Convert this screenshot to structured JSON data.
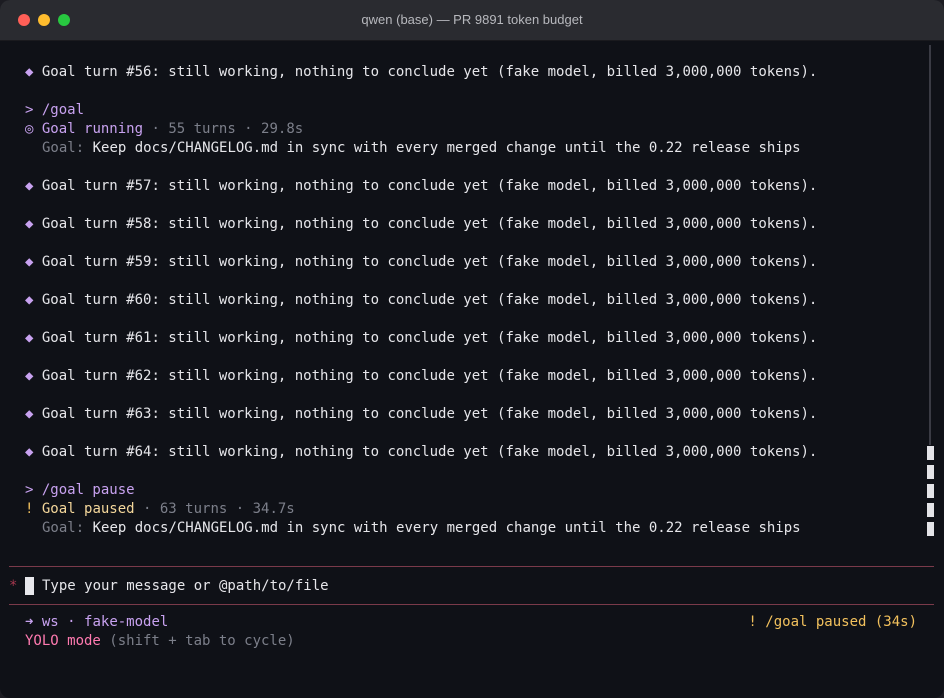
{
  "window": {
    "title": "qwen (base) — PR 9891 token budget"
  },
  "transcript": {
    "turn56": "Goal turn #56: still working, nothing to conclude yet (fake model, billed 3,000,000 tokens).",
    "cmd_goal": "> /goal",
    "running": {
      "icon": "◎",
      "status": "Goal running",
      "meta": " · 55 turns · 29.8s"
    },
    "goal_label": "Goal:",
    "goal_text": " Keep docs/CHANGELOG.md in sync with every merged change until the 0.22 release ships",
    "turns": [
      "Goal turn #57: still working, nothing to conclude yet (fake model, billed 3,000,000 tokens).",
      "Goal turn #58: still working, nothing to conclude yet (fake model, billed 3,000,000 tokens).",
      "Goal turn #59: still working, nothing to conclude yet (fake model, billed 3,000,000 tokens).",
      "Goal turn #60: still working, nothing to conclude yet (fake model, billed 3,000,000 tokens).",
      "Goal turn #61: still working, nothing to conclude yet (fake model, billed 3,000,000 tokens).",
      "Goal turn #62: still working, nothing to conclude yet (fake model, billed 3,000,000 tokens).",
      "Goal turn #63: still working, nothing to conclude yet (fake model, billed 3,000,000 tokens).",
      "Goal turn #64: still working, nothing to conclude yet (fake model, billed 3,000,000 tokens)."
    ],
    "bullet": "◆",
    "cmd_pause": "> /goal pause",
    "paused": {
      "icon": "!",
      "status": "Goal paused",
      "meta": " · 63 turns · 34.7s"
    }
  },
  "prompt": {
    "marker": "*",
    "placeholder": "Type your message or @path/to/file"
  },
  "footer": {
    "arrow": "➜",
    "workspace": "ws",
    "sep": " · ",
    "model": "fake-model",
    "mode": "YOLO mode",
    "mode_hint": " (shift + tab to cycle)",
    "goal_status": "! /goal paused (34s)"
  },
  "colors": {
    "accent_purple": "#c8a2f0",
    "paused_amber": "#f4d79b",
    "yolo_pink": "#ff7ab0",
    "rule": "#7a3a4a"
  }
}
